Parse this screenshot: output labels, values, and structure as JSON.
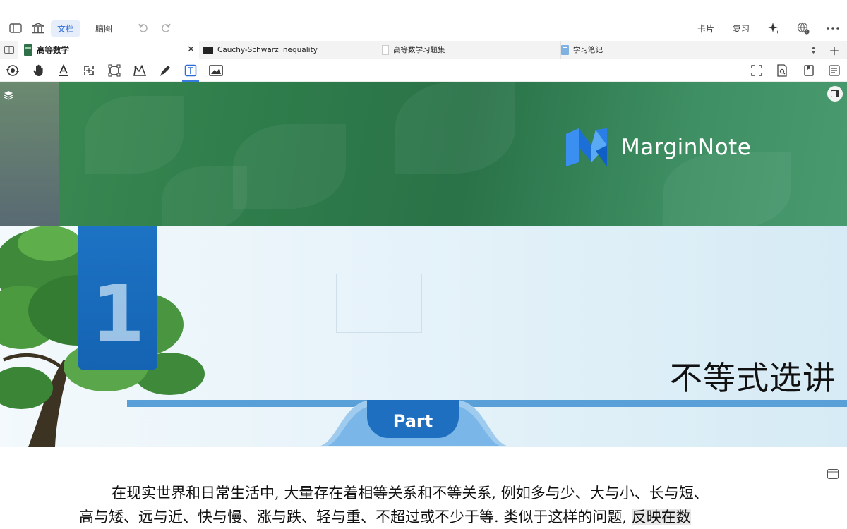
{
  "topbar": {
    "mode_doc": "文档",
    "mode_mindmap": "脑图",
    "card": "卡片",
    "review": "复习"
  },
  "tabs": [
    {
      "label": "高等数学",
      "active": true
    },
    {
      "label": "Cauchy-Schwarz inequality",
      "active": false
    },
    {
      "label": "高等数学习题集",
      "active": false
    },
    {
      "label": "学习笔记",
      "active": false
    }
  ],
  "document": {
    "logo_text": "MarginNote",
    "chapter_number": "1",
    "chapter_title": "不等式选讲",
    "part_label": "Part",
    "paragraph_line1": "在现实世界和日常生活中, 大量存在着相等关系和不等关系, 例如多与少、大与小、长与短、",
    "paragraph_line2_a": "高与矮、远与近、快与慢、涨与跌、轻与重、不超过或不少于等. 类似于这样的问题, ",
    "paragraph_line2_b": "反映在数"
  },
  "colors": {
    "accent": "#2d6bd6",
    "banner_green": "#2f7d4b",
    "part_blue": "#1f6fc1",
    "stripe_blue": "#5aa0d8"
  }
}
